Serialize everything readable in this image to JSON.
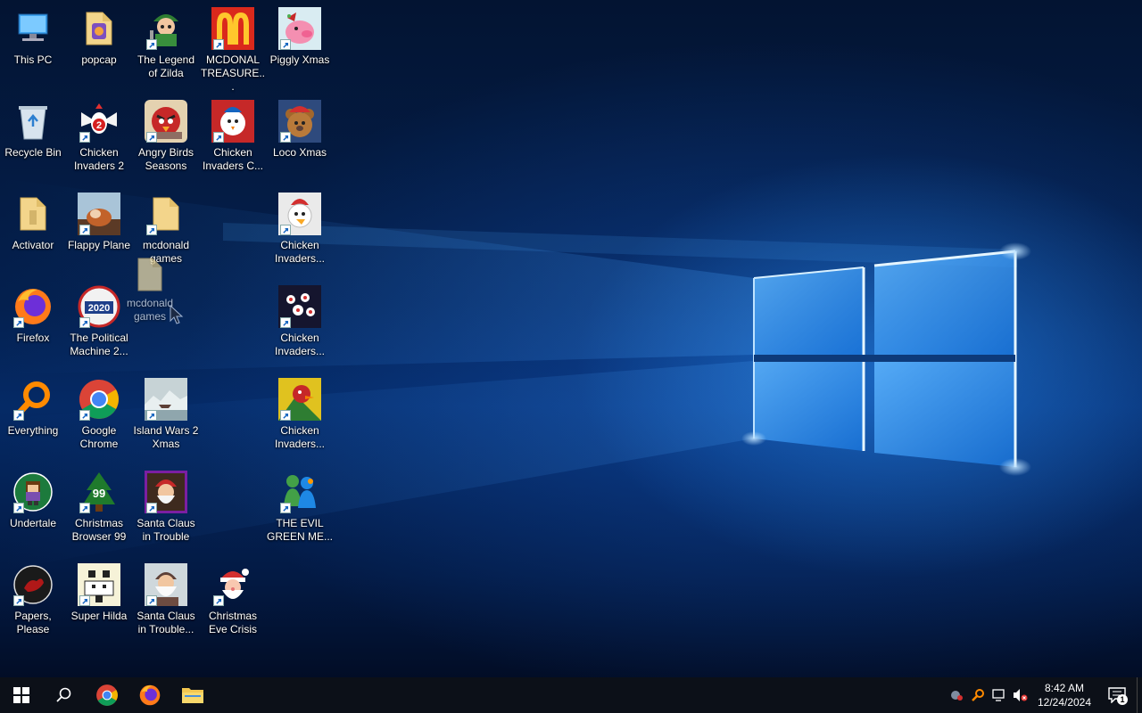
{
  "desktop": {
    "icons": [
      {
        "label": "This PC",
        "icon": "computer-icon"
      },
      {
        "label": "popcap",
        "icon": "folder-icon"
      },
      {
        "label": "The Legend of Zilda",
        "icon": "game-icon"
      },
      {
        "label": "MCDONAL TREASURE...",
        "icon": "mcdonalds-icon"
      },
      {
        "label": "Piggly Xmas",
        "icon": "pig-icon"
      },
      {
        "label": "Recycle Bin",
        "icon": "recycle-bin-icon"
      },
      {
        "label": "Chicken Invaders 2",
        "icon": "chicken-icon"
      },
      {
        "label": "Angry Birds Seasons",
        "icon": "angry-bird-icon"
      },
      {
        "label": "Chicken Invaders C...",
        "icon": "chicken-icon"
      },
      {
        "label": "Loco Xmas",
        "icon": "bear-icon"
      },
      {
        "label": "Activator",
        "icon": "folder-icon"
      },
      {
        "label": "Flappy Plane",
        "icon": "game-icon"
      },
      {
        "label": "mcdonald games",
        "icon": "folder-icon"
      },
      {
        "label": "Chicken Invaders...",
        "icon": "chicken-icon"
      },
      {
        "label": "Firefox",
        "icon": "firefox-icon"
      },
      {
        "label": "The Political Machine 2...",
        "icon": "political-icon"
      },
      {
        "label": "Chicken Invaders...",
        "icon": "chicken-icon"
      },
      {
        "label": "Everything",
        "icon": "search-icon"
      },
      {
        "label": "Google Chrome",
        "icon": "chrome-icon"
      },
      {
        "label": "Island Wars 2 Xmas",
        "icon": "island-icon"
      },
      {
        "label": "Chicken Invaders...",
        "icon": "chicken-icon"
      },
      {
        "label": "Undertale",
        "icon": "undertale-icon"
      },
      {
        "label": "Christmas Browser 99",
        "icon": "tree-icon"
      },
      {
        "label": "Santa Claus in Trouble",
        "icon": "santa-icon"
      },
      {
        "label": "THE EVIL GREEN ME...",
        "icon": "messenger-icon"
      },
      {
        "label": "Papers, Please",
        "icon": "papers-icon"
      },
      {
        "label": "Super Hilda",
        "icon": "pixel-icon"
      },
      {
        "label": "Santa Claus in Trouble...",
        "icon": "santa-icon"
      },
      {
        "label": "Christmas Eve Crisis",
        "icon": "santa-icon"
      }
    ],
    "drag_ghost": {
      "label": "mcdonald games",
      "icon": "folder-icon"
    }
  },
  "taskbar": {
    "start": "windows-start-icon",
    "search": "search-icon",
    "pinned": [
      "chrome-icon",
      "firefox-icon",
      "file-explorer-icon"
    ],
    "tray": {
      "icons": [
        "bug-icon",
        "everything-icon",
        "network-icon",
        "volume-muted-icon"
      ],
      "time": "8:42 AM",
      "date": "12/24/2024",
      "notification_count": "1"
    }
  },
  "colors": {
    "taskbar": "#0c1018",
    "wallpaper_deep": "#031432",
    "wallpaper_glow": "#2f8ef0"
  }
}
